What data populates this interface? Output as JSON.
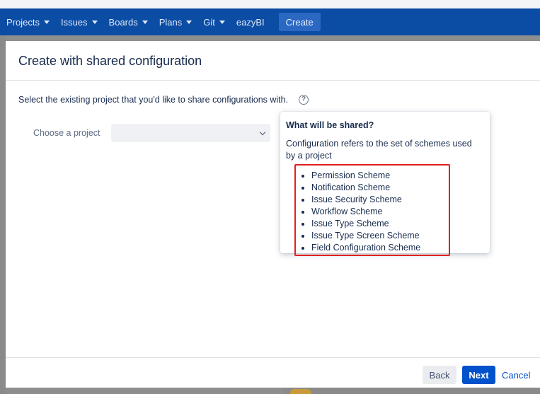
{
  "topbar": {
    "nav_items": [
      {
        "label": "Projects",
        "has_caret": true
      },
      {
        "label": "Issues",
        "has_caret": true
      },
      {
        "label": "Boards",
        "has_caret": true
      },
      {
        "label": "Plans",
        "has_caret": true
      },
      {
        "label": "Git",
        "has_caret": true
      },
      {
        "label": "eazyBI",
        "has_caret": false
      }
    ],
    "create_label": "Create"
  },
  "dialog": {
    "title": "Create with shared configuration",
    "intro": "Select the existing project that you'd like to share configurations with.",
    "help_icon": "question-circle-icon",
    "choose_label": "Choose a project",
    "project_select_value": ""
  },
  "popup": {
    "title": "What will be shared?",
    "description": "Configuration refers to the set of schemes used by a project",
    "schemes": [
      "Permission Scheme",
      "Notification Scheme",
      "Issue Security Scheme",
      "Workflow Scheme",
      "Issue Type Scheme",
      "Issue Type Screen Scheme",
      "Field Configuration Scheme"
    ]
  },
  "footer": {
    "back_label": "Back",
    "next_label": "Next",
    "cancel_label": "Cancel"
  },
  "colors": {
    "nav_bg": "#0b4ca5",
    "primary": "#0052cc",
    "highlight_box": "#e02020"
  }
}
